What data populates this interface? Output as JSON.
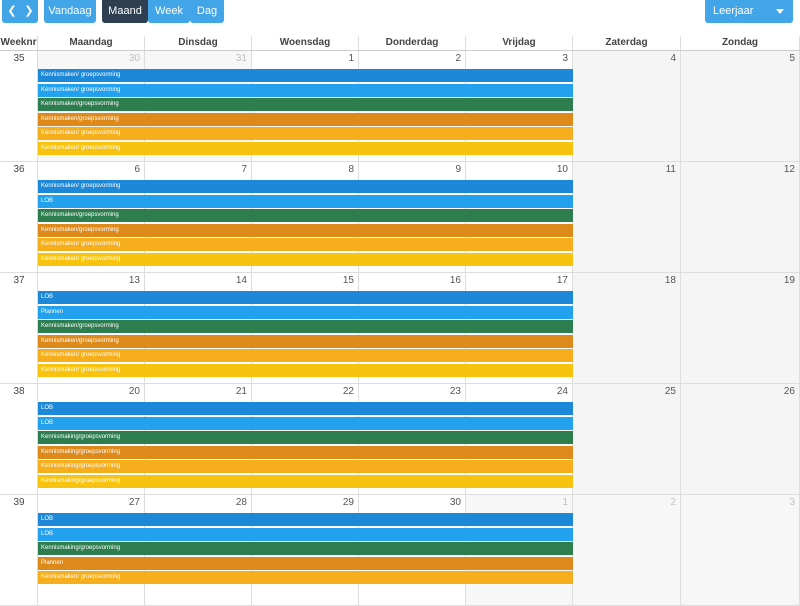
{
  "toolbar": {
    "prev_icon": "chevron-left-icon",
    "next_icon": "chevron-right-icon",
    "today_label": "Vandaag",
    "view_buttons": [
      {
        "label": "Maand",
        "active": true
      },
      {
        "label": "Week",
        "active": false
      },
      {
        "label": "Dag",
        "active": false
      }
    ],
    "select_value": "Leerjaar"
  },
  "headers": [
    "Weeknr",
    "Maandag",
    "Dinsdag",
    "Woensdag",
    "Donderdag",
    "Vrijdag",
    "Zaterdag",
    "Zondag"
  ],
  "colors": {
    "c1": "#1e88d8",
    "c2": "#22a2ee",
    "c3": "#2e7d4f",
    "c4": "#de8a1b",
    "c5": "#f6ae1c",
    "c6": "#f8c30e",
    "button": "#42a5e8",
    "button_active": "#2e3f52"
  },
  "weeks": [
    {
      "number": "35",
      "days": [
        {
          "n": "30",
          "other": true
        },
        {
          "n": "31",
          "other": true
        },
        {
          "n": "1",
          "other": false
        },
        {
          "n": "2",
          "other": false
        },
        {
          "n": "3",
          "other": false
        },
        {
          "n": "4",
          "other": false
        },
        {
          "n": "5",
          "other": false
        }
      ],
      "events": [
        {
          "title": "Kennismaken/ groepsvorming",
          "color": "c1"
        },
        {
          "title": "Kennismaken/ groepsvorming",
          "color": "c2"
        },
        {
          "title": "Kennismaken/groepsvorming",
          "color": "c3"
        },
        {
          "title": "Kennismaken/groepsvorming",
          "color": "c4"
        },
        {
          "title": "Kennismaken/ groepsvorming",
          "color": "c5"
        },
        {
          "title": "Kennismaken/ groepsvorming",
          "color": "c6"
        }
      ]
    },
    {
      "number": "36",
      "days": [
        {
          "n": "6",
          "other": false
        },
        {
          "n": "7",
          "other": false
        },
        {
          "n": "8",
          "other": false
        },
        {
          "n": "9",
          "other": false
        },
        {
          "n": "10",
          "other": false
        },
        {
          "n": "11",
          "other": false
        },
        {
          "n": "12",
          "other": false
        }
      ],
      "events": [
        {
          "title": "Kennismaken/ groepsvorming",
          "color": "c1"
        },
        {
          "title": "LOB",
          "color": "c2"
        },
        {
          "title": "Kennismaken/groepsvorming",
          "color": "c3"
        },
        {
          "title": "Kennismaken/groepsvorming",
          "color": "c4"
        },
        {
          "title": "Kennismaken/ groepsvorming",
          "color": "c5"
        },
        {
          "title": "Kennismaken/ groepsvorming",
          "color": "c6"
        }
      ]
    },
    {
      "number": "37",
      "days": [
        {
          "n": "13",
          "other": false
        },
        {
          "n": "14",
          "other": false
        },
        {
          "n": "15",
          "other": false
        },
        {
          "n": "16",
          "other": false
        },
        {
          "n": "17",
          "other": false
        },
        {
          "n": "18",
          "other": false
        },
        {
          "n": "19",
          "other": false
        }
      ],
      "events": [
        {
          "title": "LOB",
          "color": "c1"
        },
        {
          "title": "Plannen",
          "color": "c2"
        },
        {
          "title": "Kennismaken/groepsvorming",
          "color": "c3"
        },
        {
          "title": "Kennismaken/groepsvorming",
          "color": "c4"
        },
        {
          "title": "Kennismaken/ groepsvorming",
          "color": "c5"
        },
        {
          "title": "Kennismaken/ groepsvorming",
          "color": "c6"
        }
      ]
    },
    {
      "number": "38",
      "days": [
        {
          "n": "20",
          "other": false
        },
        {
          "n": "21",
          "other": false
        },
        {
          "n": "22",
          "other": false
        },
        {
          "n": "23",
          "other": false
        },
        {
          "n": "24",
          "other": false
        },
        {
          "n": "25",
          "other": false
        },
        {
          "n": "26",
          "other": false
        }
      ],
      "events": [
        {
          "title": "LOB",
          "color": "c1"
        },
        {
          "title": "LOB",
          "color": "c2"
        },
        {
          "title": "Kennismaking/groepsvorming",
          "color": "c3"
        },
        {
          "title": "Kennismaking/groepsvorming",
          "color": "c4"
        },
        {
          "title": "Kennismaking/groepsvorming",
          "color": "c5"
        },
        {
          "title": "Kennismaking/groepsvorming",
          "color": "c6"
        }
      ]
    },
    {
      "number": "39",
      "days": [
        {
          "n": "27",
          "other": false
        },
        {
          "n": "28",
          "other": false
        },
        {
          "n": "29",
          "other": false
        },
        {
          "n": "30",
          "other": false
        },
        {
          "n": "1",
          "other": true
        },
        {
          "n": "2",
          "other": true
        },
        {
          "n": "3",
          "other": true
        }
      ],
      "events": [
        {
          "title": "LOB",
          "color": "c1"
        },
        {
          "title": "LOB",
          "color": "c2"
        },
        {
          "title": "Kennismaking/groepsvorming",
          "color": "c3"
        },
        {
          "title": "Plannen",
          "color": "c4"
        },
        {
          "title": "Kennismaken/ groepsvorming",
          "color": "c5"
        }
      ]
    }
  ]
}
